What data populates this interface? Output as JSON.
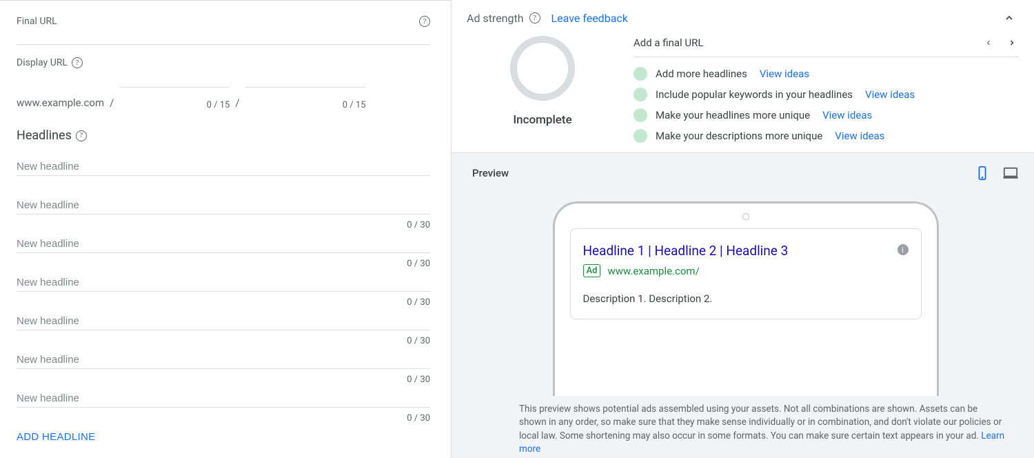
{
  "left": {
    "final_url_label": "Final URL",
    "display_url_label": "Display URL",
    "display_url_base": "www.example.com",
    "path_counter": "0 / 15",
    "headlines_label": "Headlines",
    "headline_placeholder": "New headline",
    "headline_counter": "0 / 30",
    "headlines_count": 7,
    "add_headline_label": "ADD HEADLINE"
  },
  "right": {
    "ad_strength_label": "Ad strength",
    "leave_feedback": "Leave feedback",
    "gauge_label": "Incomplete",
    "details_title": "Add a final URL",
    "view_ideas": "View ideas",
    "recommendations": [
      "Add more headlines",
      "Include popular keywords in your headlines",
      "Make your headlines more unique",
      "Make your descriptions more unique"
    ]
  },
  "preview": {
    "title": "Preview",
    "ad_headline": "Headline 1 | Headline 2 | Headline 3",
    "ad_badge": "Ad",
    "ad_url": "www.example.com/",
    "ad_description": "Description 1. Description 2.",
    "footer_text": "This preview shows potential ads assembled using your assets. Not all combinations are shown. Assets can be shown in any order, so make sure that they make sense individually or in combination, and don't violate our policies or local law. Some shortening may also occur in some formats. You can make sure certain text appears in your ad. ",
    "learn_more": "Learn more"
  }
}
